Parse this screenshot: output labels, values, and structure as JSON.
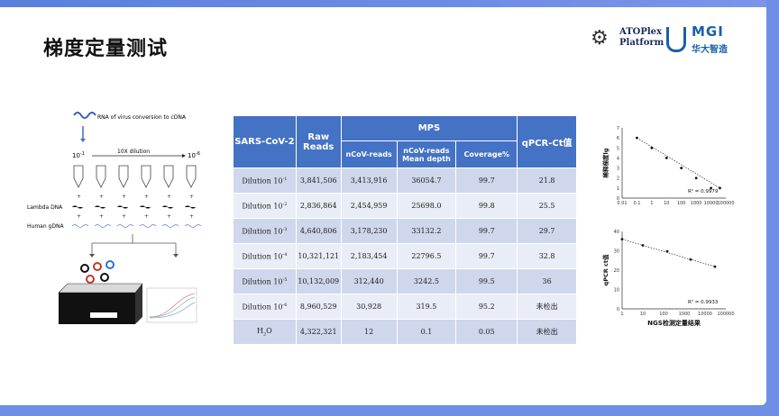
{
  "title": "梯度定量测试",
  "logo": {
    "atoplex_line1": "ATOPlex",
    "atoplex_line2": "Platform",
    "mgi_name": "MGI",
    "mgi_cn": "华大智造"
  },
  "diagram": {
    "rna_label": "RNA of virus conversion to cDNA",
    "start_dilution": "10",
    "start_exp": "-1",
    "end_dilution": "10",
    "end_exp": "-6",
    "step_label": "10X dilution",
    "lambda_label": "Lambda DNA",
    "human_label": "Human gDNA"
  },
  "table": {
    "headers": {
      "sample": "SARS-CoV-2",
      "raw": "Raw Reads",
      "mps": "MPS",
      "ncov_reads": "nCoV-reads",
      "mean_depth": "nCoV-reads Mean depth",
      "coverage": "Coverage%",
      "qpcr": "qPCR-Ct值"
    },
    "rows": [
      {
        "label": "Dilution 10",
        "exp": "-1",
        "raw": "3,841,506",
        "ncov": "3,413,916",
        "depth": "36054.7",
        "cov": "99.7",
        "ct": "21.8"
      },
      {
        "label": "Dilution 10",
        "exp": "-2",
        "raw": "2,836,864",
        "ncov": "2,454,959",
        "depth": "25698.0",
        "cov": "99.8",
        "ct": "25.5"
      },
      {
        "label": "Dilution 10",
        "exp": "-3",
        "raw": "4,640,806",
        "ncov": "3,178,230",
        "depth": "33132.2",
        "cov": "99.7",
        "ct": "29.7"
      },
      {
        "label": "Dilution 10",
        "exp": "-4",
        "raw": "10,321,121",
        "ncov": "2,183,454",
        "depth": "22796.5",
        "cov": "99.7",
        "ct": "32.8"
      },
      {
        "label": "Dilution 10",
        "exp": "-5",
        "raw": "10,132,009",
        "ncov": "312,440",
        "depth": "3242.5",
        "cov": "99.5",
        "ct": "36"
      },
      {
        "label": "Dilution 10",
        "exp": "-6",
        "raw": "8,960,529",
        "ncov": "30,928",
        "depth": "319.5",
        "cov": "95.2",
        "ct": "未检出"
      },
      {
        "label": "H",
        "sub": "2",
        "label_suffix": "O",
        "raw": "4,322,321",
        "ncov": "12",
        "depth": "0.1",
        "cov": "0.05",
        "ct": "未检出"
      }
    ]
  },
  "chart_data": [
    {
      "type": "scatter",
      "ylabel": "稀释梯度lg",
      "xlabel": "",
      "x": [
        0.1,
        1,
        10,
        100,
        1000,
        10000,
        100000
      ],
      "y": [
        6,
        5,
        4,
        3,
        2,
        1,
        0
      ],
      "points_x": [
        0.1,
        1,
        10,
        100,
        1000,
        10000,
        40000
      ],
      "points_y": [
        6,
        5,
        4,
        3,
        2,
        1,
        1
      ],
      "x_log": true,
      "xticks": [
        "0.01",
        "0.1",
        "1",
        "10",
        "100",
        "1000",
        "10000",
        "100000"
      ],
      "ylim": [
        0,
        7
      ],
      "yticks": [
        "0",
        "1",
        "2",
        "3",
        "4",
        "5",
        "6",
        "7"
      ],
      "annotation": "R² = 0.9979"
    },
    {
      "type": "scatter",
      "ylabel": "qPCR ct值",
      "xlabel": "NGS检测定量结果",
      "points_x": [
        1,
        10,
        150,
        2000,
        30000
      ],
      "points_y": [
        36,
        32.8,
        29.7,
        25.5,
        21.8
      ],
      "x_log": true,
      "xticks": [
        "1",
        "10",
        "100",
        "1000",
        "10000",
        "100000"
      ],
      "ylim": [
        0,
        40
      ],
      "yticks": [
        "0",
        "10",
        "20",
        "30",
        "40"
      ],
      "annotation": "R² = 0.9933"
    }
  ]
}
